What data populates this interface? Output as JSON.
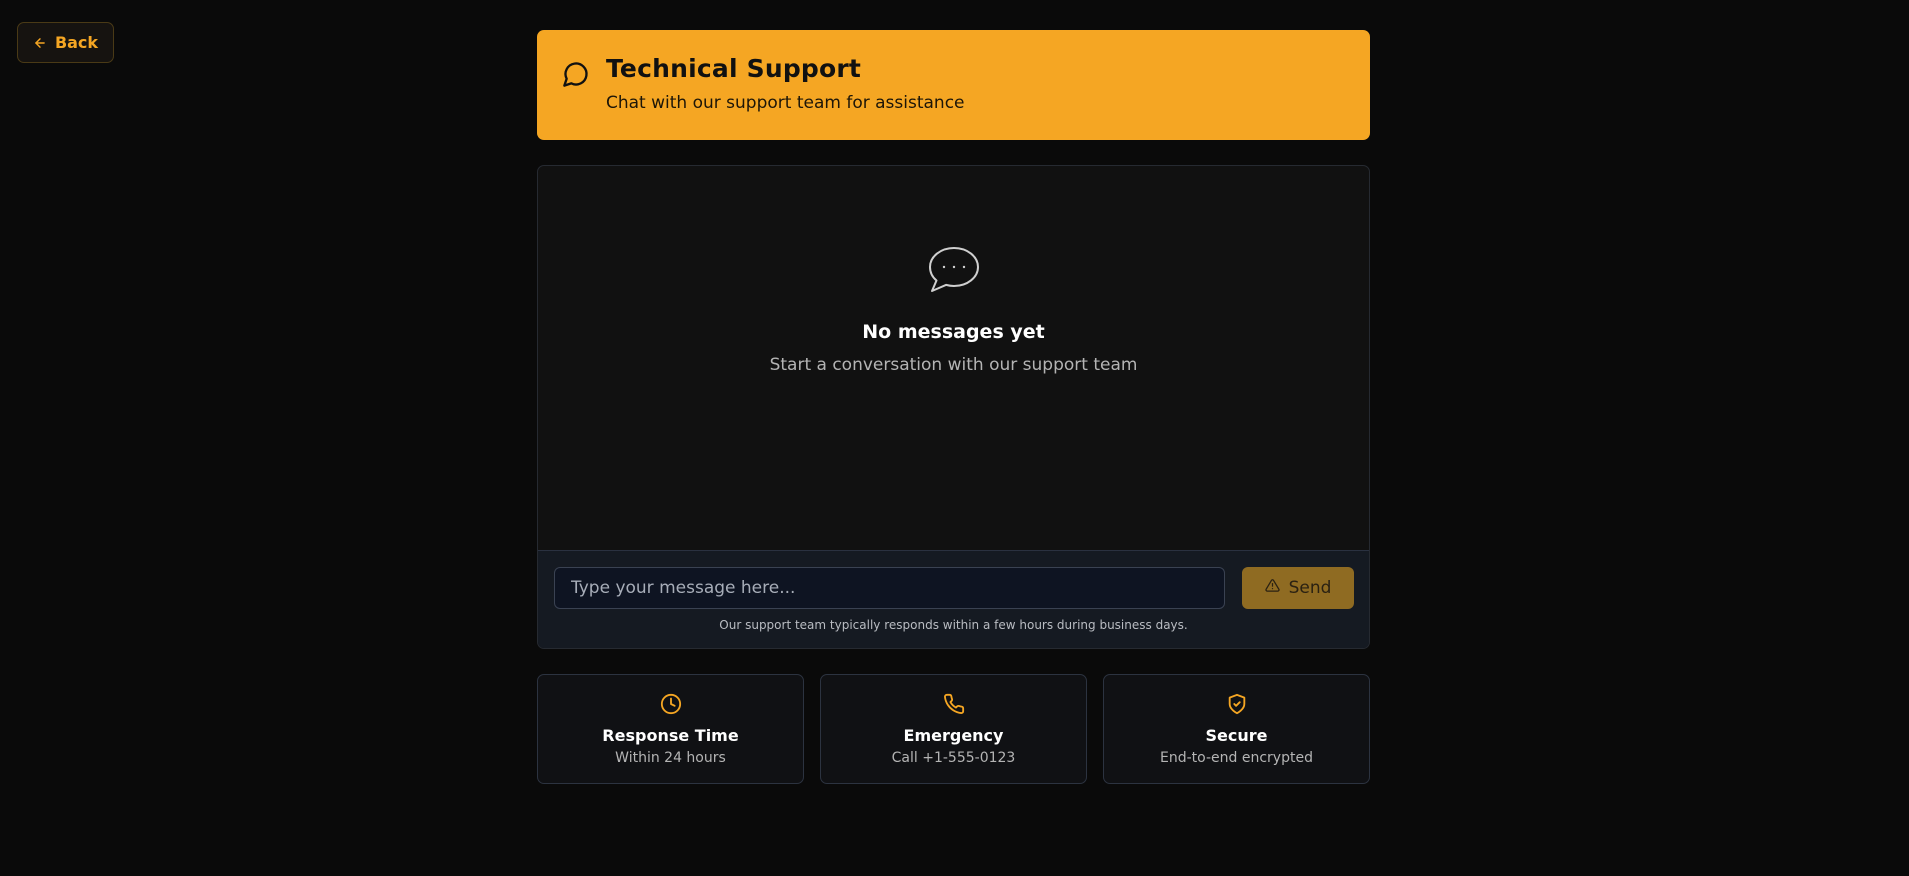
{
  "nav": {
    "back_label": "Back"
  },
  "header": {
    "icon": "message-circle-icon",
    "title": "Technical Support",
    "subtitle": "Chat with our support team for assistance"
  },
  "chat": {
    "empty_icon": "message-dots-icon",
    "empty_title": "No messages yet",
    "empty_subtitle": "Start a conversation with our support team"
  },
  "composer": {
    "placeholder": "Type your message here...",
    "value": "",
    "send_label": "Send",
    "send_icon": "alert-triangle-icon",
    "note": "Our support team typically responds within a few hours during business days."
  },
  "cards": [
    {
      "icon": "clock-icon",
      "title": "Response Time",
      "subtitle": "Within 24 hours"
    },
    {
      "icon": "phone-icon",
      "title": "Emergency",
      "subtitle": "Call +1-555-0123"
    },
    {
      "icon": "shield-check-icon",
      "title": "Secure",
      "subtitle": "End-to-end encrypted"
    }
  ],
  "colors": {
    "background": "#0a0a0a",
    "accent": "#f5a623",
    "panel": "#111111",
    "composer": "#151a22",
    "send_button": "#8f6b22"
  }
}
